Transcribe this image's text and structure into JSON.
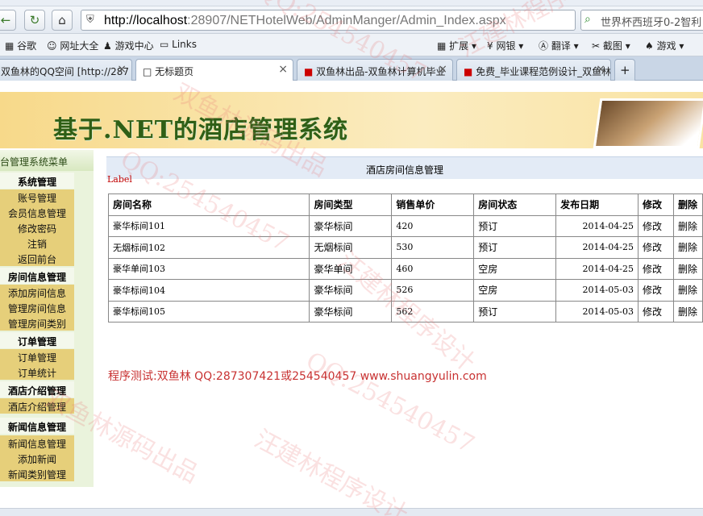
{
  "browser": {
    "url_host": "http://localhost",
    "url_rest": ":28907/NETHotelWeb/AdminManger/Admin_Index.aspx",
    "search_text": "世界杯西班牙0-2智利",
    "bookmarks": [
      "谷歌",
      "网址大全",
      "游戏中心",
      "Links",
      "扩展",
      "网银",
      "翻译",
      "截图",
      "游戏"
    ],
    "tabs": [
      {
        "label": "双鱼林的QQ空间 [http://287"
      },
      {
        "label": "无标题页"
      },
      {
        "label": "双鱼林出品-双鱼林计算机毕业"
      },
      {
        "label": "免费_毕业课程范例设计_双鱼林"
      }
    ],
    "new_tab": "+"
  },
  "banner": {
    "title": "基于.NET的酒店管理系统"
  },
  "sidebar": {
    "header": "台管理系统菜单",
    "groups": [
      {
        "title": "系统管理",
        "items": [
          "账号管理",
          "会员信息管理",
          "修改密码",
          "注销",
          "返回前台"
        ]
      },
      {
        "title": "房间信息管理",
        "items": [
          "添加房间信息",
          "管理房间信息",
          "管理房间类别"
        ]
      },
      {
        "title": "订单管理",
        "items": [
          "订单管理",
          "订单统计"
        ]
      },
      {
        "title": "酒店介绍管理",
        "items": [
          "酒店介绍管理"
        ]
      },
      {
        "title": "新闻信息管理",
        "items": [
          "新闻信息管理",
          "添加新闻",
          "新闻类别管理"
        ]
      }
    ]
  },
  "main": {
    "panel_title": "酒店房间信息管理",
    "label": "Label",
    "columns": [
      "房间名称",
      "房间类型",
      "销售单价",
      "房间状态",
      "发布日期",
      "修改",
      "删除"
    ],
    "rows": [
      {
        "name": "豪华标间101",
        "type": "豪华标间",
        "price": "420",
        "status": "预订",
        "date": "2014-04-25",
        "edit": "修改",
        "del": "删除"
      },
      {
        "name": "无烟标间102",
        "type": "无烟标间",
        "price": "530",
        "status": "预订",
        "date": "2014-04-25",
        "edit": "修改",
        "del": "删除"
      },
      {
        "name": "豪华单间103",
        "type": "豪华单间",
        "price": "460",
        "status": "空房",
        "date": "2014-04-25",
        "edit": "修改",
        "del": "删除"
      },
      {
        "name": "豪华标间104",
        "type": "豪华标间",
        "price": "526",
        "status": "空房",
        "date": "2014-05-03",
        "edit": "修改",
        "del": "删除"
      },
      {
        "name": "豪华标间105",
        "type": "豪华标间",
        "price": "562",
        "status": "预订",
        "date": "2014-05-03",
        "edit": "修改",
        "del": "删除"
      }
    ],
    "credit": "程序测试:双鱼林 QQ:287307421或254540457 www.shuangyulin.com"
  },
  "watermarks": [
    "QQ:254540457",
    "汪建林程序设计",
    "双鱼林源码出品",
    "QQ:254540457",
    "汪建林程序设计",
    "双鱼林源码出品",
    "QQ:254540457",
    "汪建林程序设计"
  ],
  "colors": {
    "menu_item_bg": "#e6cf7a",
    "credit_text": "#c83232",
    "label_text": "#c00000",
    "banner_title": "#2f5f16"
  }
}
